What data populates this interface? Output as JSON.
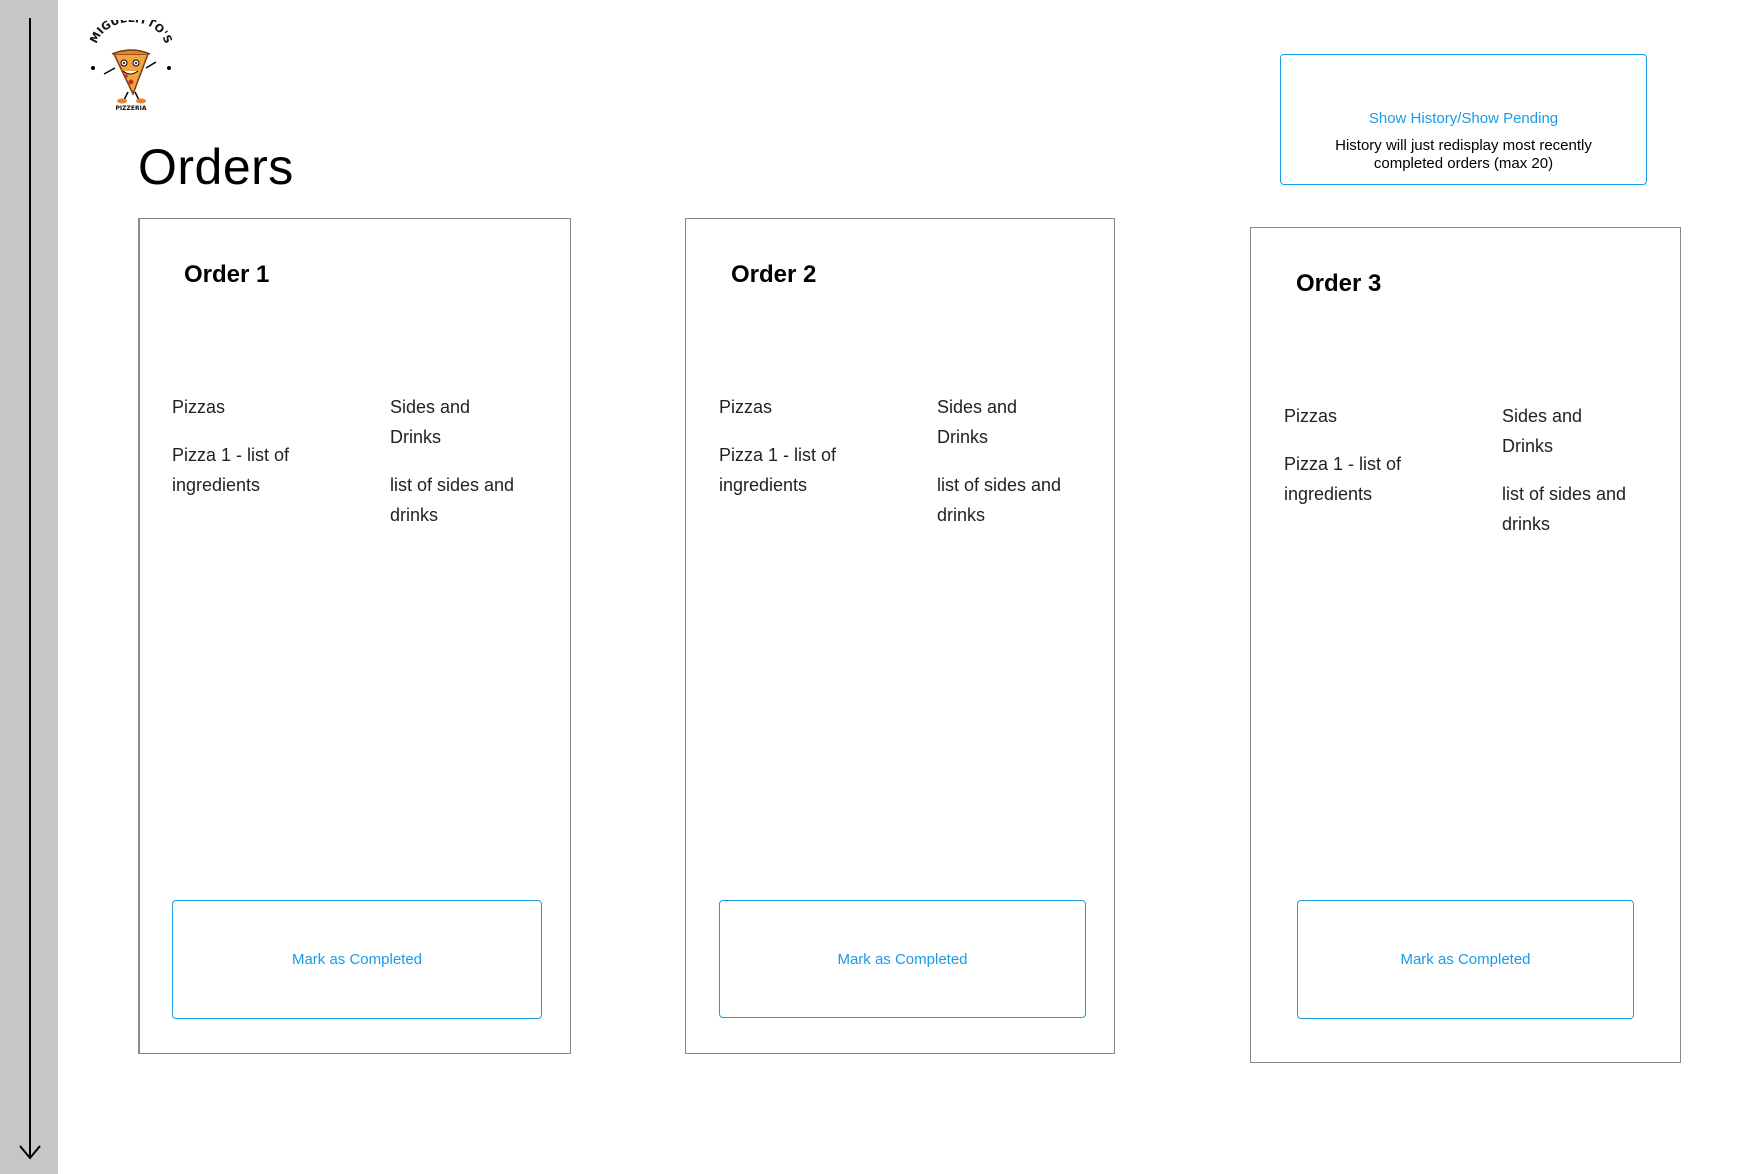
{
  "logo": {
    "top_text": "MIGUELITTO'S",
    "bottom_text": "PIZZERIA",
    "icon": "pizza-mascot-icon"
  },
  "page_title": "Orders",
  "history_button": {
    "label": "Show History/Show Pending",
    "note": "History will  just redisplay most recently completed orders (max 20)"
  },
  "orders": [
    {
      "title": "Order 1",
      "pizzas_heading": "Pizzas",
      "pizza_item": "Pizza 1 - list of ingredients",
      "sides_heading": "Sides and Drinks",
      "sides_item": "list of sides and drinks",
      "button_label": "Mark as Completed"
    },
    {
      "title": "Order 2",
      "pizzas_heading": "Pizzas",
      "pizza_item": "Pizza 1 - list of ingredients",
      "sides_heading": "Sides and Drinks",
      "sides_item": "list of sides and drinks",
      "button_label": "Mark as Completed"
    },
    {
      "title": "Order 3",
      "pizzas_heading": "Pizzas",
      "pizza_item": "Pizza 1 - list of ingredients",
      "sides_heading": "Sides and Drinks",
      "sides_item": "list of sides and drinks",
      "button_label": "Mark as Completed"
    }
  ],
  "colors": {
    "accent": "#1a9be8",
    "rail": "#c6c6c6",
    "card_border": "#8a8a8a"
  }
}
